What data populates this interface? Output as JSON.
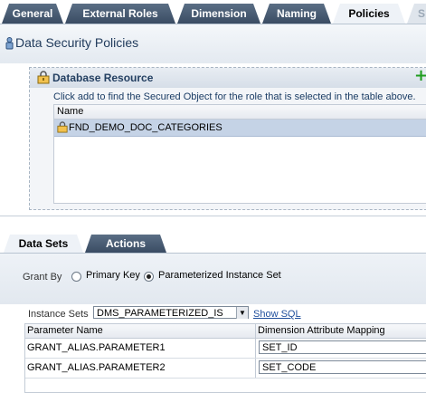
{
  "tabs": [
    {
      "label": "General",
      "state": "inactive"
    },
    {
      "label": "External Roles",
      "state": "inactive"
    },
    {
      "label": "Dimension",
      "state": "inactive"
    },
    {
      "label": "Naming",
      "state": "inactive"
    },
    {
      "label": "Policies",
      "state": "active"
    },
    {
      "label": "S",
      "state": "disabled"
    }
  ],
  "header": {
    "title": "Data Security Policies",
    "icon": "policy-icon"
  },
  "db_resource": {
    "title": "Database Resource",
    "add_icon": "plus-icon",
    "hint": "Click add to find the Secured Object for the role that is selected in the table above.",
    "table": {
      "column": "Name",
      "rows": [
        "FND_DEMO_DOC_CATEGORIES"
      ]
    }
  },
  "lower_tabs": [
    {
      "label": "Data Sets",
      "state": "active"
    },
    {
      "label": "Actions",
      "state": "inactive"
    }
  ],
  "grant_by": {
    "label": "Grant By",
    "options": [
      "Primary Key",
      "Parameterized Instance Set"
    ],
    "selected": "Parameterized Instance Set"
  },
  "instance_sets": {
    "label": "Instance Sets",
    "value": "DMS_PARAMETERIZED_IS",
    "link": "Show SQL"
  },
  "params_table": {
    "headers": [
      "Parameter Name",
      "Dimension Attribute Mapping"
    ],
    "rows": [
      {
        "name": "GRANT_ALIAS.PARAMETER1",
        "mapping": "SET_ID"
      },
      {
        "name": "GRANT_ALIAS.PARAMETER2",
        "mapping": "SET_CODE"
      }
    ]
  },
  "colors": {
    "tab_dark": "#3a4c63",
    "title_blue": "#213b5c",
    "selection": "#c5d3e6",
    "link": "#1f4e9c",
    "add_green": "#1f9d1f"
  }
}
